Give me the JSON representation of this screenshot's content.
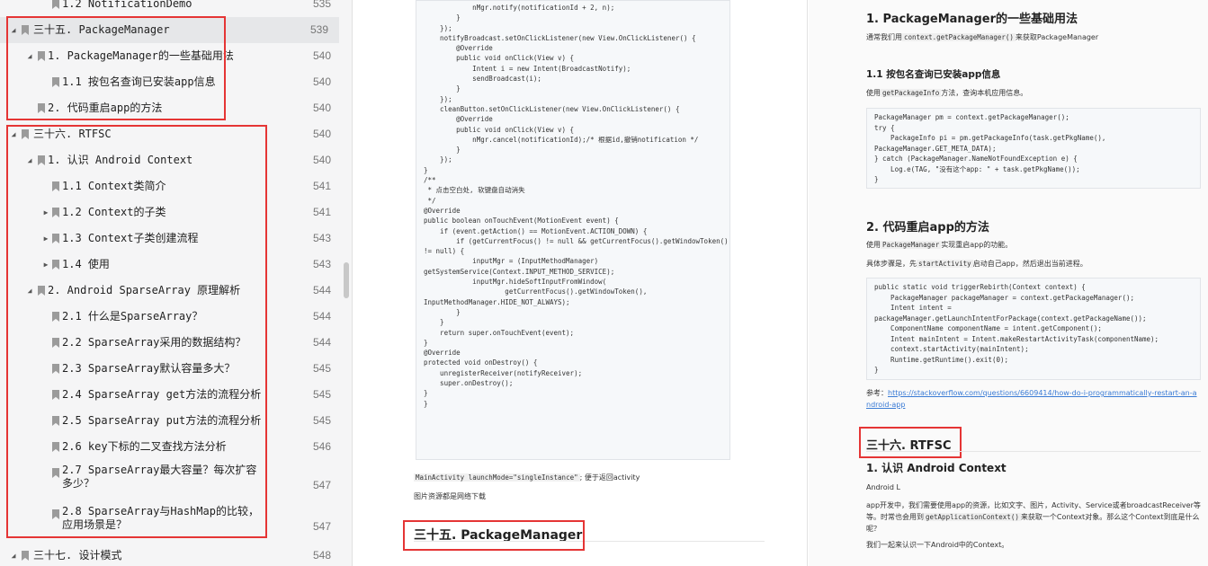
{
  "sidebar": {
    "items": [
      {
        "level": 2,
        "toggle": "",
        "label": "1.2 NotificationDemo",
        "page": "535"
      },
      {
        "level": 0,
        "toggle": "◢",
        "label": "三十五. PackageManager",
        "page": "539",
        "selected": true
      },
      {
        "level": 1,
        "toggle": "◢",
        "label": "1. PackageManager的一些基础用法",
        "page": "540"
      },
      {
        "level": 2,
        "toggle": "",
        "label": "1.1 按包名查询已安装app信息",
        "page": "540"
      },
      {
        "level": 1,
        "toggle": "",
        "label": "2. 代码重启app的方法",
        "page": "540"
      },
      {
        "level": 0,
        "toggle": "◢",
        "label": "三十六. RTFSC",
        "page": "540"
      },
      {
        "level": 1,
        "toggle": "◢",
        "label": "1. 认识 Android Context",
        "page": "540"
      },
      {
        "level": 2,
        "toggle": "",
        "label": "1.1 Context类简介",
        "page": "541"
      },
      {
        "level": 2,
        "toggle": "▶",
        "label": "1.2 Context的子类",
        "page": "541"
      },
      {
        "level": 2,
        "toggle": "▶",
        "label": "1.3 Context子类创建流程",
        "page": "543"
      },
      {
        "level": 2,
        "toggle": "▶",
        "label": "1.4 使用",
        "page": "543"
      },
      {
        "level": 1,
        "toggle": "◢",
        "label": "2. Android SparseArray 原理解析",
        "page": "544"
      },
      {
        "level": 2,
        "toggle": "",
        "label": "2.1 什么是SparseArray？",
        "page": "544"
      },
      {
        "level": 2,
        "toggle": "",
        "label": "2.2 SparseArray采用的数据结构？",
        "page": "544"
      },
      {
        "level": 2,
        "toggle": "",
        "label": "2.3 SparseArray默认容量多大？",
        "page": "545"
      },
      {
        "level": 2,
        "toggle": "",
        "label": "2.4 SparseArray get方法的流程分析",
        "page": "545"
      },
      {
        "level": 2,
        "toggle": "",
        "label": "2.5 SparseArray put方法的流程分析",
        "page": "545"
      },
      {
        "level": 2,
        "toggle": "",
        "label": "2.6 key下标的二叉查找方法分析",
        "page": "546"
      },
      {
        "level": 2,
        "toggle": "",
        "label": "2.7 SparseArray最大容量？每次扩容多少？",
        "page": "547",
        "tall": true
      },
      {
        "level": 2,
        "toggle": "",
        "label": "2.8 SparseArray与HashMap的比较，应用场景是？",
        "page": "547",
        "tall": true
      },
      {
        "level": 0,
        "toggle": "◢",
        "label": "三十七. 设计模式",
        "page": "548"
      }
    ]
  },
  "page1": {
    "code_lines": [
      "            nMgr.notify(notificationId + 2, n);",
      "        }",
      "    });",
      "",
      "    notifyBroadcast.setOnClickListener(new View.OnClickListener() {",
      "        @Override",
      "        public void onClick(View v) {",
      "            Intent i = new Intent(BroadcastNotify);",
      "            sendBroadcast(i);",
      "        }",
      "    });",
      "",
      "    cleanButton.setOnClickListener(new View.OnClickListener() {",
      "        @Override",
      "        public void onClick(View v) {",
      "            nMgr.cancel(notificationId);/* 根据id,撤销notification */",
      "        }",
      "    });",
      "}",
      "",
      "/**",
      " * 点击空白处, 软键盘自动消失",
      " */",
      "@Override",
      "public boolean onTouchEvent(MotionEvent event) {",
      "    if (event.getAction() == MotionEvent.ACTION_DOWN) {",
      "        if (getCurrentFocus() != null && getCurrentFocus().getWindowToken()",
      "!= null) {",
      "            inputMgr = (InputMethodManager)",
      "getSystemService(Context.INPUT_METHOD_SERVICE);",
      "            inputMgr.hideSoftInputFromWindow(",
      "                    getCurrentFocus().getWindowToken(),",
      "InputMethodManager.HIDE_NOT_ALWAYS);",
      "        }",
      "    }",
      "    return super.onTouchEvent(event);",
      "}",
      "",
      "@Override",
      "protected void onDestroy() {",
      "    unregisterReceiver(notifyReceiver);",
      "    super.onDestroy();",
      "}",
      "}"
    ],
    "launch_mode_code": "MainActivity launchMode=\"singleInstance\"",
    "launch_mode_text": "; 便于返回activity",
    "image_source_text": "图片资源都是网络下载",
    "heading": "三十五. PackageManager"
  },
  "page2": {
    "h_pm_basic": "1. PackageManager的一些基础用法",
    "pm_intro_pre": "通常我们用",
    "pm_intro_code": "context.getPackageManager()",
    "pm_intro_post": "来获取PackageManager",
    "h_query": "1.1 按包名查询已安装app信息",
    "query_pre": "使用",
    "query_code": "getPackageInfo",
    "query_post": "方法，查询本机应用信息。",
    "code1": [
      "PackageManager pm = context.getPackageManager();",
      "try {",
      "    PackageInfo pi = pm.getPackageInfo(task.getPkgName(),",
      "PackageManager.GET_META_DATA);",
      "} catch (PackageManager.NameNotFoundException e) {",
      "    Log.e(TAG, \"没有这个app: \" + task.getPkgName());",
      "}"
    ],
    "h_restart": "2. 代码重启app的方法",
    "restart_pre": "使用",
    "restart_code": "PackageManager",
    "restart_post": "实现重启app的功能。",
    "steps_pre": "具体步骤是，先",
    "steps_code": "startActivity",
    "steps_post": "启动自己app，然后退出当前进程。",
    "code2": [
      "public static void triggerRebirth(Context context) {",
      "    PackageManager packageManager = context.getPackageManager();",
      "    Intent intent =",
      "packageManager.getLaunchIntentForPackage(context.getPackageName());",
      "    ComponentName componentName = intent.getComponent();",
      "    Intent mainIntent = Intent.makeRestartActivityTask(componentName);",
      "    context.startActivity(mainIntent);",
      "    Runtime.getRuntime().exit(0);",
      "}"
    ],
    "ref_label": "参考：",
    "ref_link": "https://stackoverflow.com/questions/6609414/how-do-i-programmatically-restart-an-android-app",
    "h_rtfsc": "三十六. RTFSC",
    "h_context": "1. 认识 Android Context",
    "android_l": "Android L",
    "ctx_para_pre": "app开发中，我们需要使用app的资源，比如文字、图片，Activity、Service或者broadcastReceiver等等。时常也会用到",
    "ctx_para_code": "getApplicationContext()",
    "ctx_para_post": "来获取一个Context对象。那么这个Context到底是什么呢？",
    "ctx_last": "我们一起来认识一下Android中的Context。"
  },
  "colors": {
    "highlight_box": "#e53535",
    "selected_row": "#e6e7e9",
    "link": "#3a7bd5"
  }
}
